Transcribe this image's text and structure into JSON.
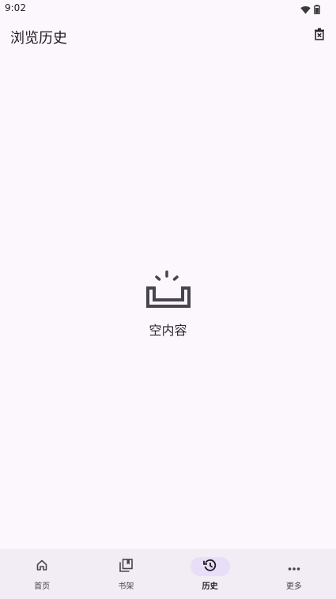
{
  "status_bar": {
    "time": "9:02"
  },
  "app_bar": {
    "title": "浏览历史",
    "clear_icon": "delete-history-icon"
  },
  "empty_state": {
    "icon": "empty-box-icon",
    "label": "空内容"
  },
  "bottom_nav": {
    "items": [
      {
        "label": "首页",
        "icon": "home-icon",
        "active": false
      },
      {
        "label": "书架",
        "icon": "bookshelf-icon",
        "active": false
      },
      {
        "label": "历史",
        "icon": "history-icon",
        "active": true
      },
      {
        "label": "更多",
        "icon": "more-icon",
        "active": false
      }
    ]
  },
  "colors": {
    "background": "#fcf7fd",
    "nav_background": "#f2ecf4",
    "active_indicator": "#e8def8",
    "text": "#1d1b20"
  }
}
